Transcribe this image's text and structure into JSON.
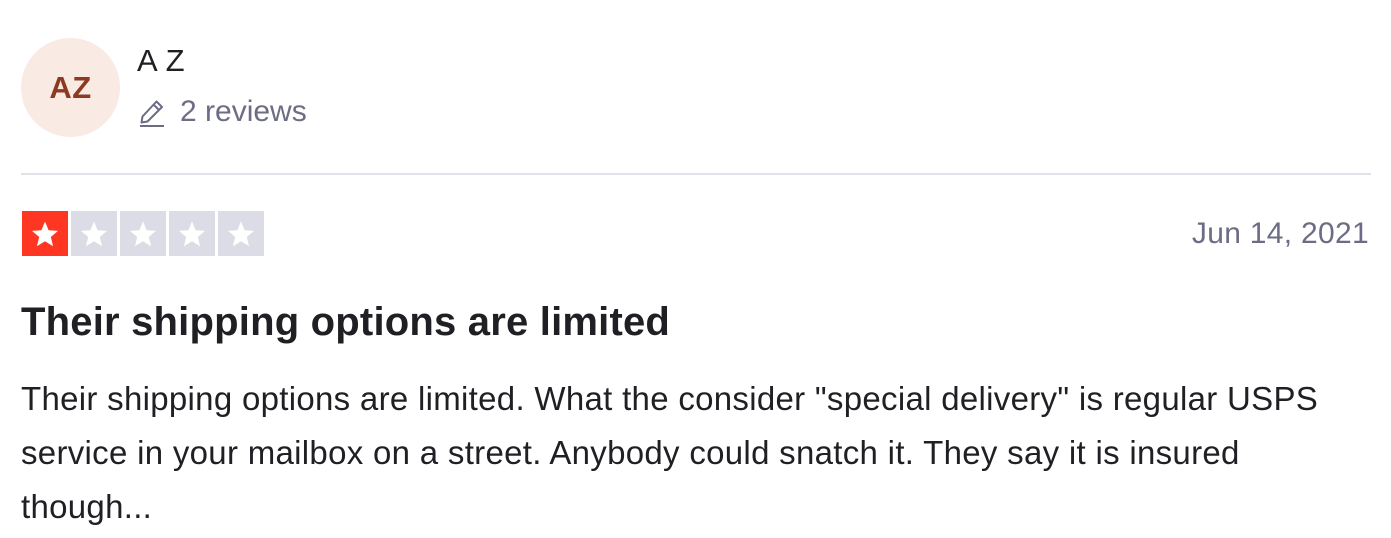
{
  "consumer": {
    "initials": "AZ",
    "name": "A Z",
    "review_count": "2 reviews",
    "avatar_bg": "#f9eae3",
    "avatar_fg": "#8c3a20"
  },
  "review": {
    "rating": 1,
    "max_rating": 5,
    "date": "Jun 14, 2021",
    "title": "Their shipping options are limited",
    "text": "Their shipping options are limited. What the consider \"special delivery\" is regular USPS service in your mailbox on a street. Anybody could snatch it. They say it is insured though..."
  },
  "colors": {
    "star_filled": "#ff3722",
    "star_empty": "#dcdce6",
    "divider": "#e1e1ea",
    "muted_text": "#6c6c85"
  },
  "icons": {
    "review_count": "pencil-icon",
    "rating": "star-icon"
  }
}
